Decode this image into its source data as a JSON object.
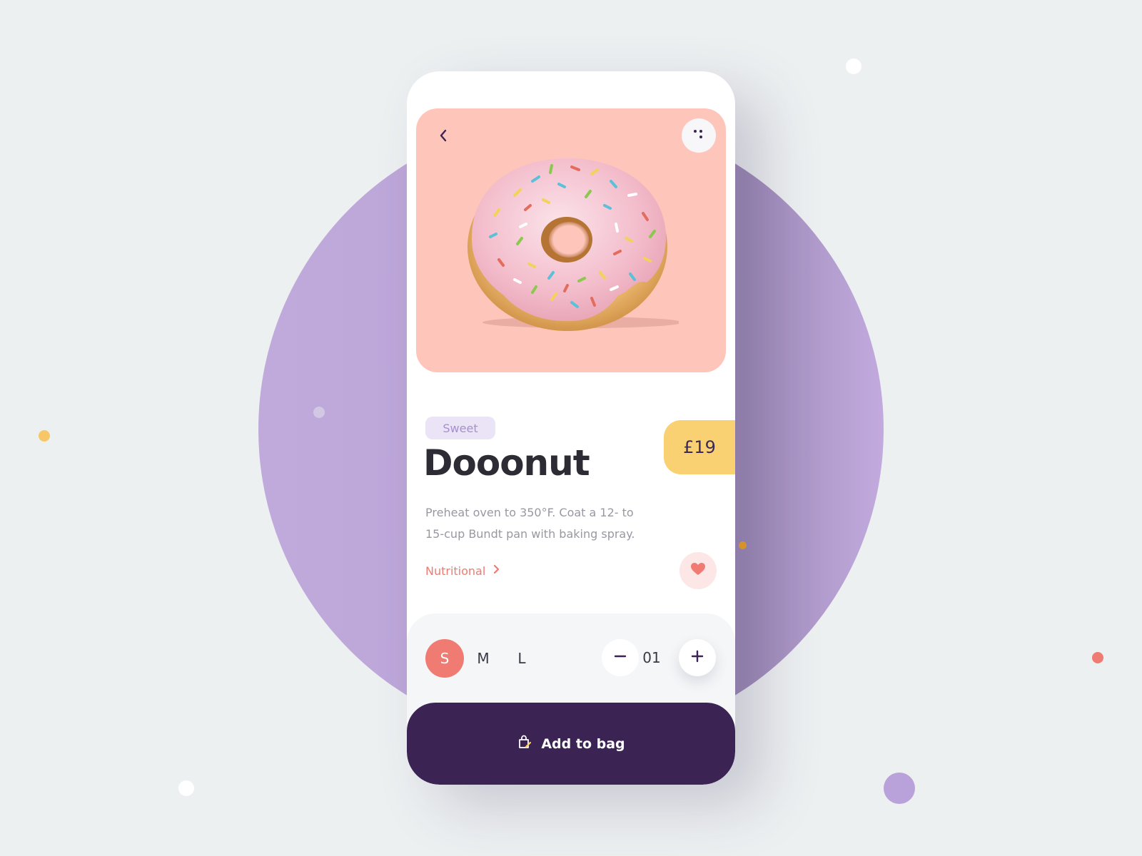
{
  "product": {
    "tag": "Sweet",
    "price": "£19",
    "name": "Dooonut",
    "description": "Preheat oven to 350°F. Coat a 12- to 15-cup Bundt pan with baking spray.",
    "nutritional_link": "Nutritional"
  },
  "sizes": {
    "options": [
      "S",
      "M",
      "L"
    ],
    "selected": "S"
  },
  "quantity": {
    "value": "01"
  },
  "cta": {
    "label": "Add to bag"
  },
  "icons": {
    "back": "chevron-left-icon",
    "menu": "dots-menu-icon",
    "nutritional": "chevron-right-icon",
    "favorite": "heart-icon",
    "decrease": "minus-icon",
    "increase": "plus-icon",
    "bag": "shopping-bag-icon"
  },
  "colors": {
    "background": "#edf0f1",
    "backdrop_circle": "#bba4d8",
    "hero_background": "#fec6bb",
    "accent_coral": "#ef7b72",
    "price_yellow": "#f9d173",
    "primary_dark": "#3b2454",
    "tag_background": "#ebe4f6",
    "tag_text": "#a68fcf"
  }
}
